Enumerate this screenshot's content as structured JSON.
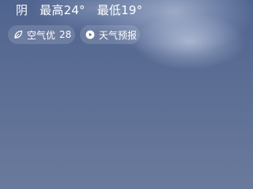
{
  "weather": {
    "condition": "阴",
    "high": "最高24°",
    "low": "最低19°"
  },
  "air_quality": {
    "label": "空气优",
    "value": "28",
    "icon": "leaf-icon"
  },
  "forecast_button": {
    "label": "天气预报",
    "icon": "play-icon"
  }
}
